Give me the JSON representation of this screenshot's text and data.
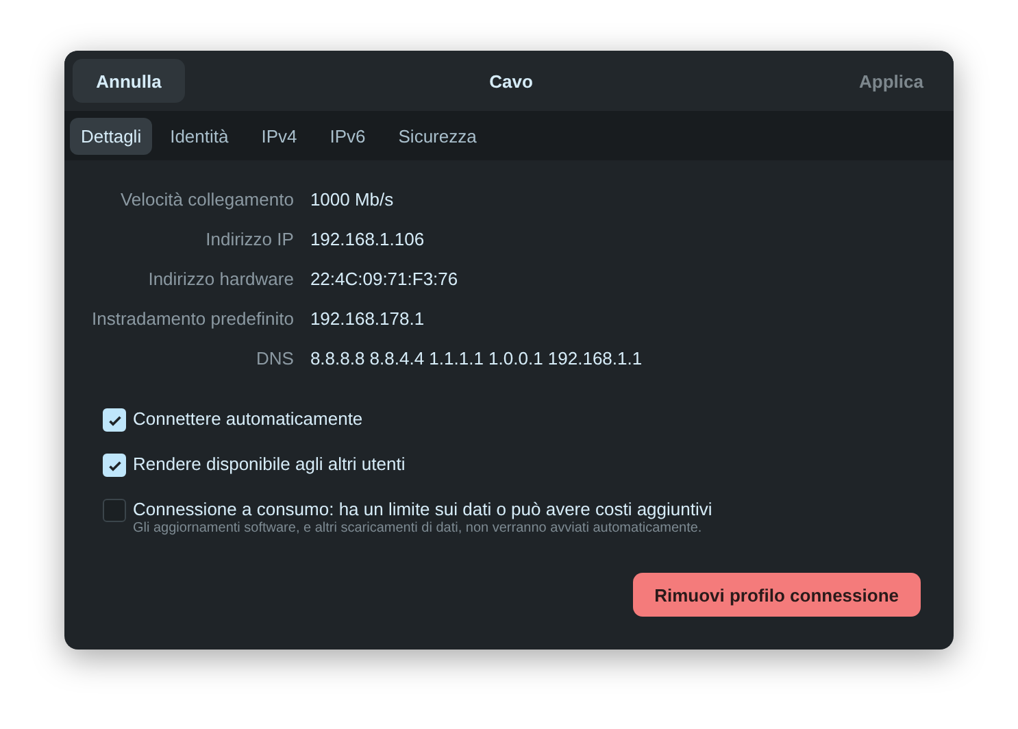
{
  "header": {
    "cancel_button": "Annulla",
    "title": "Cavo",
    "apply_button": {
      "label": "Applica",
      "disabled": true
    }
  },
  "tabs": [
    {
      "label": "Dettagli",
      "selected": true
    },
    {
      "label": "Identità",
      "selected": false
    },
    {
      "label": "IPv4",
      "selected": false
    },
    {
      "label": "IPv6",
      "selected": false
    },
    {
      "label": "Sicurezza",
      "selected": false
    }
  ],
  "details": [
    {
      "label": "Velocità collegamento",
      "value": "1000 Mb/s"
    },
    {
      "label": "Indirizzo IP",
      "value": "192.168.1.106"
    },
    {
      "label": "Indirizzo hardware",
      "value": "22:4C:09:71:F3:76"
    },
    {
      "label": "Instradamento predefinito",
      "value": "192.168.178.1"
    },
    {
      "label": "DNS",
      "value": "8.8.8.8 8.8.4.4 1.1.1.1 1.0.0.1 192.168.1.1"
    }
  ],
  "options": [
    {
      "label": "Connettere automaticamente",
      "checked": true
    },
    {
      "label": "Rendere disponibile agli altri utenti",
      "checked": true
    },
    {
      "label": "Connessione a consumo: ha un limite sui dati o può avere costi aggiuntivi",
      "hint": "Gli aggiornamenti software, e altri scaricamenti di dati, non verranno avviati automaticamente.",
      "checked": false
    }
  ],
  "remove_button": "Rimuovi profilo connessione"
}
